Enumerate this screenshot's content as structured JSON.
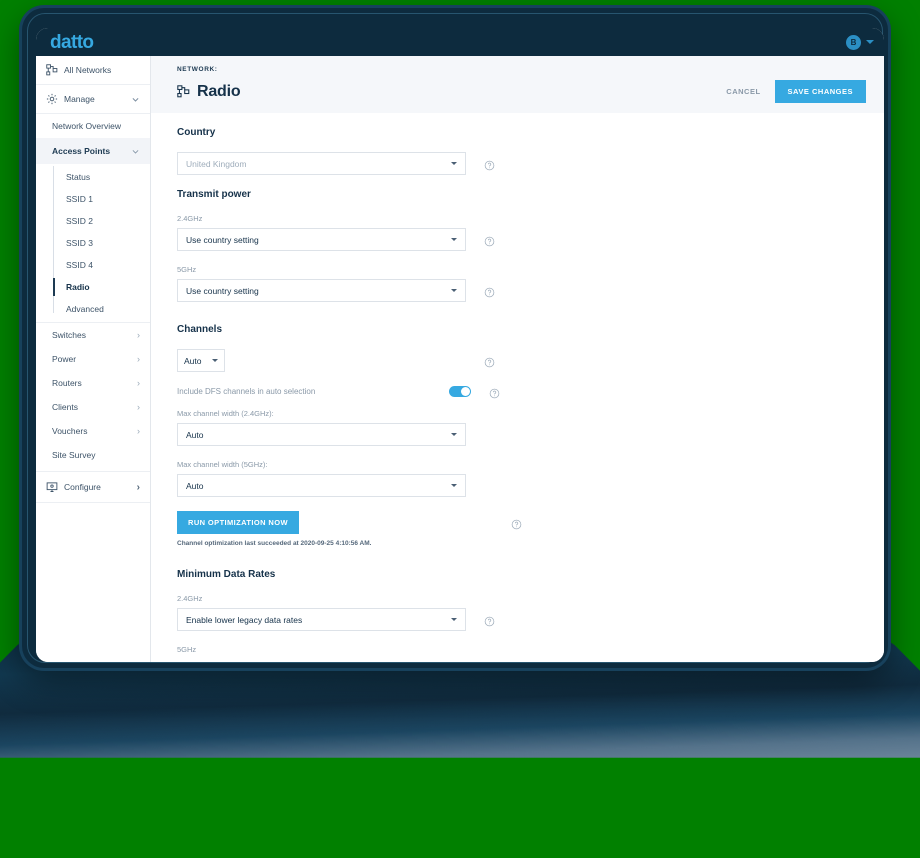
{
  "brand": {
    "logo_text": "datto"
  },
  "topbar": {
    "avatar_initial": "B"
  },
  "sidebar": {
    "all_networks": {
      "label": "All Networks",
      "icon": "network-icon"
    },
    "manage": {
      "label": "Manage",
      "icon": "gear-icon"
    },
    "network_overview": {
      "label": "Network Overview"
    },
    "access_points": {
      "label": "Access Points"
    },
    "access_points_children": [
      {
        "label": "Status",
        "active": false
      },
      {
        "label": "SSID 1",
        "active": false
      },
      {
        "label": "SSID 2",
        "active": false
      },
      {
        "label": "SSID 3",
        "active": false
      },
      {
        "label": "SSID 4",
        "active": false
      },
      {
        "label": "Radio",
        "active": true
      },
      {
        "label": "Advanced",
        "active": false
      }
    ],
    "groups": [
      {
        "label": "Switches"
      },
      {
        "label": "Power"
      },
      {
        "label": "Routers"
      },
      {
        "label": "Clients"
      },
      {
        "label": "Vouchers"
      }
    ],
    "site_survey": {
      "label": "Site Survey"
    },
    "configure": {
      "label": "Configure",
      "icon": "monitor-icon"
    }
  },
  "header": {
    "breadcrumb": "NETWORK:",
    "title": "Radio",
    "title_icon": "network-icon",
    "cancel_label": "CANCEL",
    "save_label": "SAVE CHANGES"
  },
  "form": {
    "country": {
      "section_title": "Country",
      "value": "United Kingdom"
    },
    "transmit_power": {
      "section_title": "Transmit power",
      "label_24": "2.4GHz",
      "value_24": "Use country setting",
      "label_5": "5GHz",
      "value_5": "Use country setting"
    },
    "channels": {
      "section_title": "Channels",
      "mode_value": "Auto",
      "dfs_label": "Include DFS channels in auto selection",
      "dfs_enabled": true,
      "width_24_label": "Max channel width (2.4GHz):",
      "width_24_value": "Auto",
      "width_5_label": "Max channel width (5GHz):",
      "width_5_value": "Auto",
      "run_button_label": "RUN OPTIMIZATION NOW",
      "status_text": "Channel optimization last succeeded at 2020-09-25 4:10:56 AM."
    },
    "minimum_data_rates": {
      "section_title": "Minimum Data Rates",
      "label_24": "2.4GHz",
      "value_24": "Enable lower legacy data rates",
      "label_5": "5GHz"
    }
  },
  "colors": {
    "brand_blue": "#36a9e1",
    "dark_navy": "#0d2b3e",
    "page_bg": "#018000",
    "header_bg": "#f5f7fa"
  }
}
